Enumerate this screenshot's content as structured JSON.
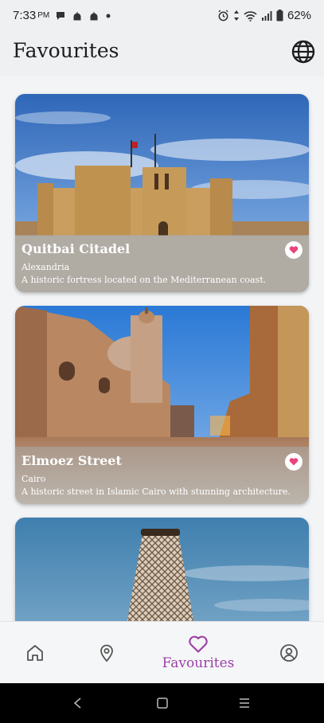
{
  "status_bar": {
    "time": "7:33",
    "ampm": "PM",
    "battery": "62%"
  },
  "header": {
    "title": "Favourites",
    "language_icon": "globe-icon"
  },
  "places": [
    {
      "title": "Quitbai Citadel",
      "city": "Alexandria",
      "description": "A historic fortress located on the Mediterranean coast.",
      "favourite": true
    },
    {
      "title": "Elmoez Street",
      "city": "Cairo",
      "description": "A historic street in Islamic Cairo with stunning architecture.",
      "favourite": true
    }
  ],
  "bottom_nav": {
    "items": [
      {
        "icon": "home-icon"
      },
      {
        "icon": "location-pin-icon"
      },
      {
        "icon": "heart-icon",
        "label": "Favourites",
        "active": true
      },
      {
        "icon": "profile-icon"
      }
    ]
  },
  "colors": {
    "accent": "#9b3fa6",
    "heart": "#e8457a"
  }
}
